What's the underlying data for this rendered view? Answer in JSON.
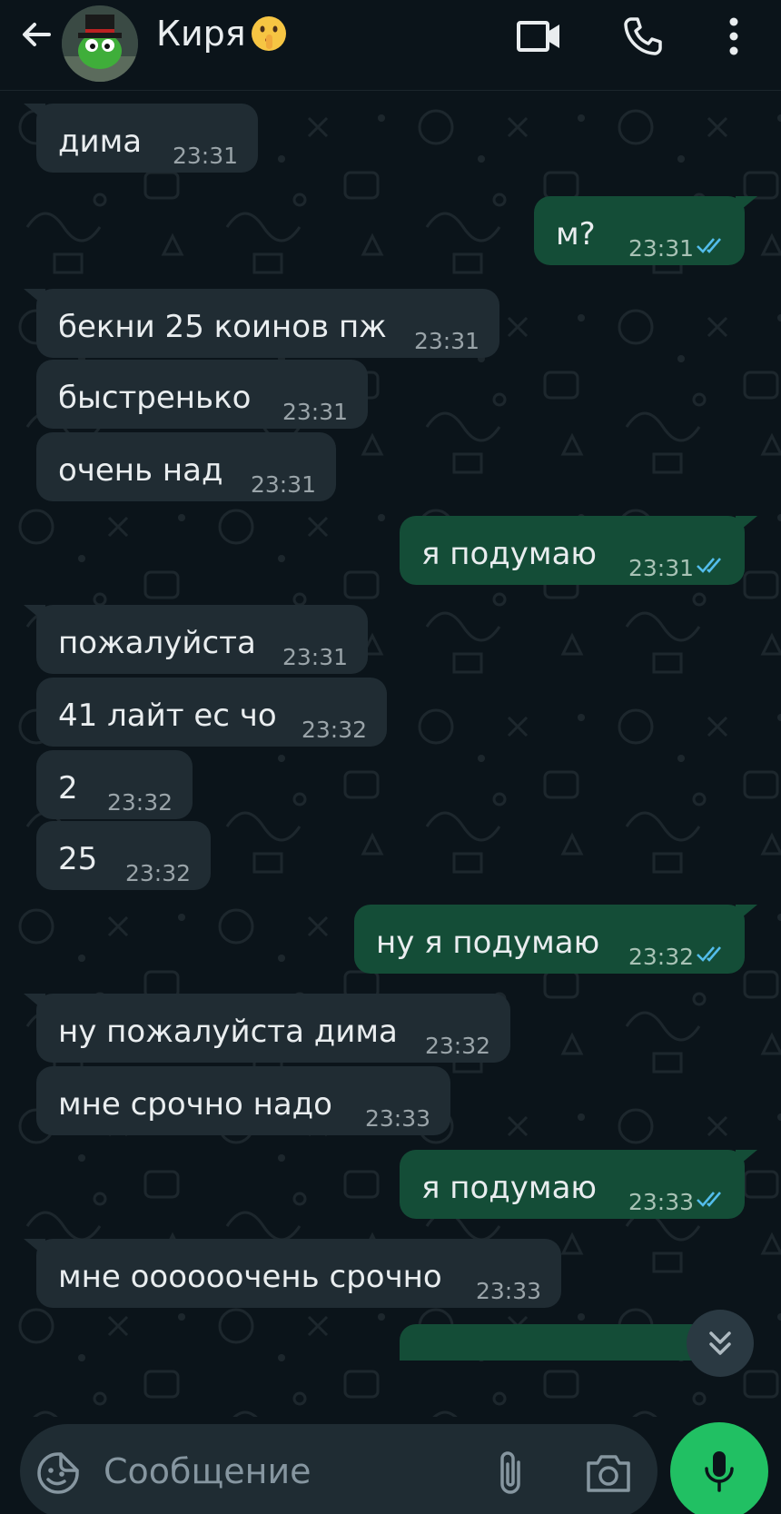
{
  "header": {
    "contact_name": "Киря",
    "back_icon": "arrow-left-icon",
    "video_icon": "video-camera-icon",
    "call_icon": "phone-icon",
    "menu_icon": "more-vertical-icon"
  },
  "messages": [
    {
      "dir": "in",
      "text": "дима",
      "time": "23:31"
    },
    {
      "dir": "out",
      "text": "м?",
      "time": "23:31"
    },
    {
      "dir": "in",
      "text": "бекни 25 коинов пж",
      "time": "23:31"
    },
    {
      "dir": "in",
      "text": "быстренько",
      "time": "23:31"
    },
    {
      "dir": "in",
      "text": "очень над",
      "time": "23:31"
    },
    {
      "dir": "out",
      "text": "я подумаю",
      "time": "23:31"
    },
    {
      "dir": "in",
      "text": "пожалуйста",
      "time": "23:31"
    },
    {
      "dir": "in",
      "text": "41 лайт ес чо",
      "time": "23:32"
    },
    {
      "dir": "in",
      "text": "2",
      "time": "23:32"
    },
    {
      "dir": "in",
      "text": "25",
      "time": "23:32"
    },
    {
      "dir": "out",
      "text": "ну я подумаю",
      "time": "23:32"
    },
    {
      "dir": "in",
      "text": "ну пожалуйста дима",
      "time": "23:32"
    },
    {
      "dir": "in",
      "text": "мне срочно надо",
      "time": "23:33"
    },
    {
      "dir": "out",
      "text": "я подумаю",
      "time": "23:33"
    },
    {
      "dir": "in",
      "text": "мне оооооочень срочно",
      "time": "23:33"
    }
  ],
  "input": {
    "placeholder": "Сообщение"
  },
  "colors": {
    "background": "#0b141a",
    "incoming_bubble": "#202c33",
    "outgoing_bubble": "#144d37",
    "read_ticks": "#53bdeb",
    "mic_button": "#21c063"
  }
}
